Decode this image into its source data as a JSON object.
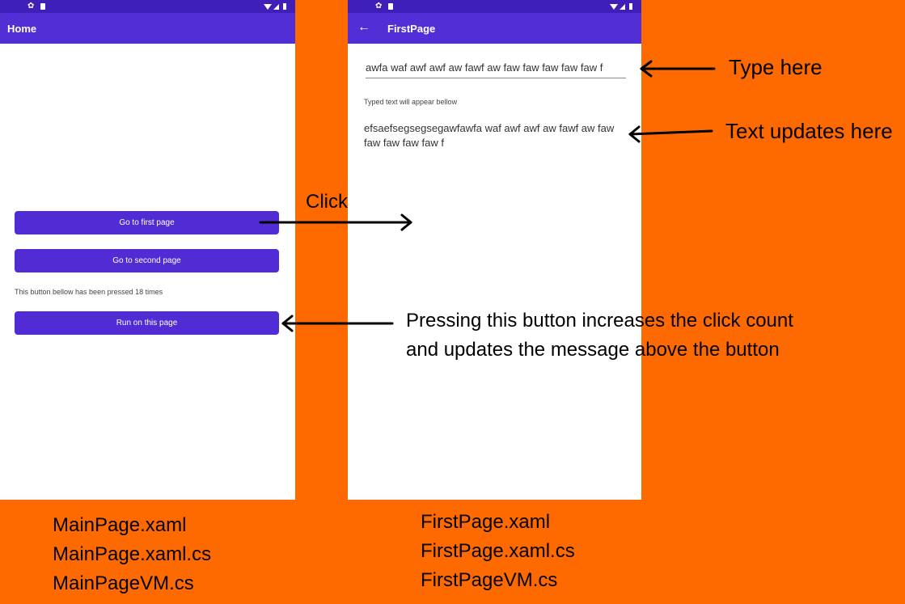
{
  "main_page": {
    "title": "Home",
    "buttons": {
      "first": "Go to first page",
      "second": "Go to second page",
      "run": "Run on this page"
    },
    "counter_text": "This button bellow has been pressed 18 times"
  },
  "first_page": {
    "title": "FirstPage",
    "entry_value": "awfa waf awf awf aw fawf aw faw faw faw faw faw f",
    "hint_text": "Typed text will appear bellow",
    "echo_text": "efsaefsegsegsegawfawfa waf awf awf aw fawf aw faw faw faw faw faw f"
  },
  "annotations": {
    "type_here": "Type here",
    "text_updates": "Text updates here",
    "click": "Click",
    "pressing_line1": "Pressing this button increases the click count",
    "pressing_line2": "and updates the message above the button"
  },
  "files": {
    "main": [
      "MainPage.xaml",
      "MainPage.xaml.cs",
      "MainPageVM.cs"
    ],
    "first": [
      "FirstPage.xaml",
      "FirstPage.xaml.cs",
      "FirstPageVM.cs"
    ]
  },
  "colors": {
    "background": "#FF6A00",
    "app_bar": "#522ED7",
    "status_bar": "#3E1FB8",
    "button": "#512BD4"
  },
  "icons": [
    "settings-icon",
    "sd-card-icon",
    "wifi-icon",
    "signal-icon",
    "battery-icon",
    "back-arrow-icon"
  ]
}
